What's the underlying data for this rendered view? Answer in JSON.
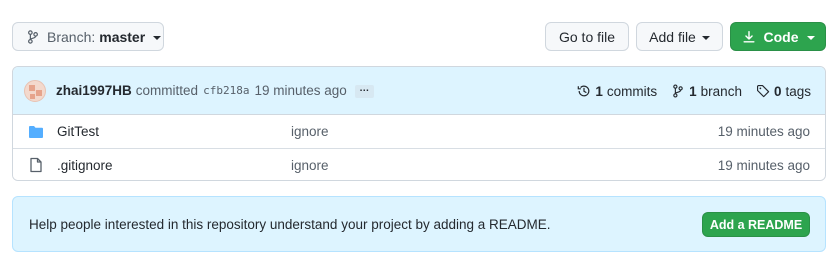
{
  "toolbar": {
    "branch_prefix": "Branch:",
    "branch_name": "master",
    "goto_file": "Go to file",
    "add_file": "Add file",
    "code": "Code"
  },
  "commit": {
    "author": "zhai1997HB",
    "action": "committed",
    "sha": "cfb218a",
    "time": "19 minutes ago",
    "ellipsis": "…",
    "stats": {
      "commits_count": "1",
      "commits_label": "commits",
      "branches_count": "1",
      "branches_label": "branch",
      "tags_count": "0",
      "tags_label": "tags"
    }
  },
  "files": [
    {
      "name": "GitTest",
      "type": "folder",
      "message": "ignore",
      "time": "19 minutes ago"
    },
    {
      "name": ".gitignore",
      "type": "file",
      "message": "ignore",
      "time": "19 minutes ago"
    }
  ],
  "readme": {
    "text": "Help people interested in this repository understand your project by adding a README.",
    "button": "Add a README"
  },
  "colors": {
    "accent_green": "#2da44e",
    "header_blue": "#ddf4ff",
    "folder_blue": "#54aeff"
  }
}
